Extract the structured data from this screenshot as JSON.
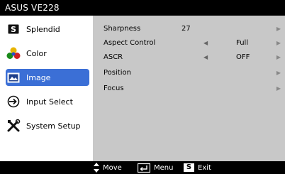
{
  "title": "ASUS VE228",
  "sidebar": {
    "items": [
      {
        "label": "Splendid",
        "icon": "s-box-icon"
      },
      {
        "label": "Color",
        "icon": "color-triangle-icon"
      },
      {
        "label": "Image",
        "icon": "image-icon"
      },
      {
        "label": "Input Select",
        "icon": "input-select-icon"
      },
      {
        "label": "System Setup",
        "icon": "wrench-screwdriver-icon"
      }
    ],
    "selected": "Image"
  },
  "main": {
    "rows": [
      {
        "label": "Sharpness",
        "value": "27"
      },
      {
        "label": "Aspect Control",
        "value": "Full"
      },
      {
        "label": "ASCR",
        "value": "OFF"
      },
      {
        "label": "Position",
        "value": ""
      },
      {
        "label": "Focus",
        "value": ""
      }
    ]
  },
  "bottom": {
    "move_label": "Move",
    "menu_label": "Menu",
    "exit_label": "Exit",
    "exit_key": "S"
  },
  "colors": {
    "active_item": "#3b6fd6",
    "panel_bg": "#c8c8c8",
    "bar_bg": "#000000"
  }
}
